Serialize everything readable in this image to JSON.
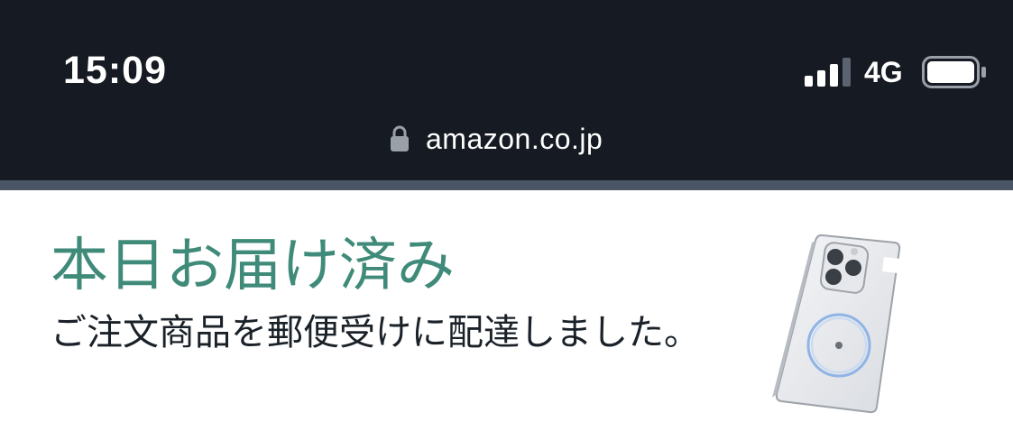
{
  "status_bar": {
    "time": "15:09",
    "network": "4G",
    "signal_bars_active": 3,
    "signal_bars_total": 4,
    "battery_level": 0.9
  },
  "browser": {
    "url": "amazon.co.jp",
    "lock_icon": "lock-icon"
  },
  "notification": {
    "headline": "本日お届け済み",
    "message": "ご注文商品を郵便受けに配達しました。",
    "product_image": "phone-case-product-image"
  },
  "colors": {
    "status_bar_bg": "#161b23",
    "headline": "#3f8a79",
    "body_text": "#1a2128",
    "divider": "#4a5566"
  }
}
